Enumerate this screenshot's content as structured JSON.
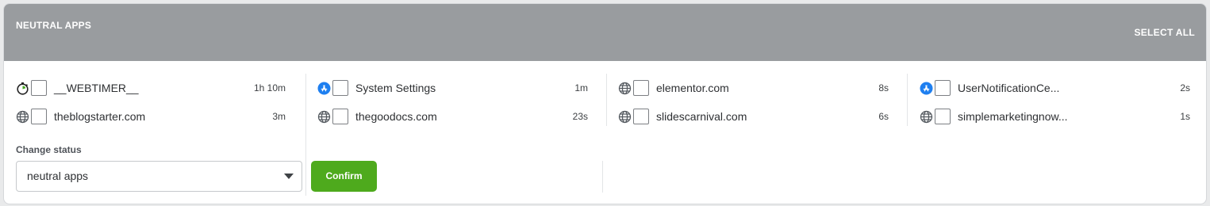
{
  "header": {
    "title": "NEUTRAL APPS",
    "select_all": "SELECT ALL",
    "background": "#999c9f"
  },
  "columns": [
    {
      "items": [
        {
          "icon": "stopwatch-icon",
          "label": "__WEBTIMER__",
          "time": "1h 10m"
        },
        {
          "icon": "globe-icon",
          "label": "theblogstarter.com",
          "time": "3m"
        }
      ]
    },
    {
      "items": [
        {
          "icon": "app-store-icon",
          "label": "System Settings",
          "time": "1m"
        },
        {
          "icon": "globe-icon",
          "label": "thegoodocs.com",
          "time": "23s"
        }
      ]
    },
    {
      "items": [
        {
          "icon": "globe-icon",
          "label": "elementor.com",
          "time": "8s"
        },
        {
          "icon": "globe-icon",
          "label": "slidescarnival.com",
          "time": "6s"
        }
      ]
    },
    {
      "items": [
        {
          "icon": "app-store-icon",
          "label": "UserNotificationCe...",
          "time": "2s"
        },
        {
          "icon": "globe-icon",
          "label": "simplemarketingnow...",
          "time": "1s"
        }
      ]
    }
  ],
  "change_status": {
    "label": "Change status",
    "selected": "neutral apps",
    "confirm_label": "Confirm",
    "confirm_color": "#4eaa1d"
  }
}
